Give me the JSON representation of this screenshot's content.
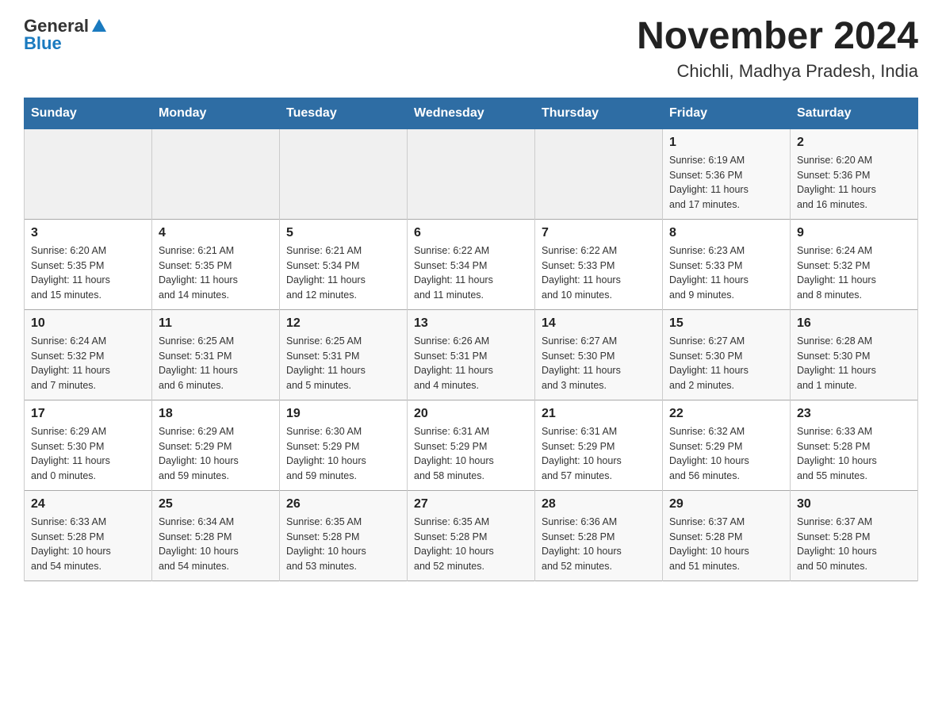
{
  "header": {
    "logo_general": "General",
    "logo_blue": "Blue",
    "month_title": "November 2024",
    "location": "Chichli, Madhya Pradesh, India"
  },
  "days_of_week": [
    "Sunday",
    "Monday",
    "Tuesday",
    "Wednesday",
    "Thursday",
    "Friday",
    "Saturday"
  ],
  "weeks": [
    [
      {
        "day": "",
        "info": ""
      },
      {
        "day": "",
        "info": ""
      },
      {
        "day": "",
        "info": ""
      },
      {
        "day": "",
        "info": ""
      },
      {
        "day": "",
        "info": ""
      },
      {
        "day": "1",
        "info": "Sunrise: 6:19 AM\nSunset: 5:36 PM\nDaylight: 11 hours\nand 17 minutes."
      },
      {
        "day": "2",
        "info": "Sunrise: 6:20 AM\nSunset: 5:36 PM\nDaylight: 11 hours\nand 16 minutes."
      }
    ],
    [
      {
        "day": "3",
        "info": "Sunrise: 6:20 AM\nSunset: 5:35 PM\nDaylight: 11 hours\nand 15 minutes."
      },
      {
        "day": "4",
        "info": "Sunrise: 6:21 AM\nSunset: 5:35 PM\nDaylight: 11 hours\nand 14 minutes."
      },
      {
        "day": "5",
        "info": "Sunrise: 6:21 AM\nSunset: 5:34 PM\nDaylight: 11 hours\nand 12 minutes."
      },
      {
        "day": "6",
        "info": "Sunrise: 6:22 AM\nSunset: 5:34 PM\nDaylight: 11 hours\nand 11 minutes."
      },
      {
        "day": "7",
        "info": "Sunrise: 6:22 AM\nSunset: 5:33 PM\nDaylight: 11 hours\nand 10 minutes."
      },
      {
        "day": "8",
        "info": "Sunrise: 6:23 AM\nSunset: 5:33 PM\nDaylight: 11 hours\nand 9 minutes."
      },
      {
        "day": "9",
        "info": "Sunrise: 6:24 AM\nSunset: 5:32 PM\nDaylight: 11 hours\nand 8 minutes."
      }
    ],
    [
      {
        "day": "10",
        "info": "Sunrise: 6:24 AM\nSunset: 5:32 PM\nDaylight: 11 hours\nand 7 minutes."
      },
      {
        "day": "11",
        "info": "Sunrise: 6:25 AM\nSunset: 5:31 PM\nDaylight: 11 hours\nand 6 minutes."
      },
      {
        "day": "12",
        "info": "Sunrise: 6:25 AM\nSunset: 5:31 PM\nDaylight: 11 hours\nand 5 minutes."
      },
      {
        "day": "13",
        "info": "Sunrise: 6:26 AM\nSunset: 5:31 PM\nDaylight: 11 hours\nand 4 minutes."
      },
      {
        "day": "14",
        "info": "Sunrise: 6:27 AM\nSunset: 5:30 PM\nDaylight: 11 hours\nand 3 minutes."
      },
      {
        "day": "15",
        "info": "Sunrise: 6:27 AM\nSunset: 5:30 PM\nDaylight: 11 hours\nand 2 minutes."
      },
      {
        "day": "16",
        "info": "Sunrise: 6:28 AM\nSunset: 5:30 PM\nDaylight: 11 hours\nand 1 minute."
      }
    ],
    [
      {
        "day": "17",
        "info": "Sunrise: 6:29 AM\nSunset: 5:30 PM\nDaylight: 11 hours\nand 0 minutes."
      },
      {
        "day": "18",
        "info": "Sunrise: 6:29 AM\nSunset: 5:29 PM\nDaylight: 10 hours\nand 59 minutes."
      },
      {
        "day": "19",
        "info": "Sunrise: 6:30 AM\nSunset: 5:29 PM\nDaylight: 10 hours\nand 59 minutes."
      },
      {
        "day": "20",
        "info": "Sunrise: 6:31 AM\nSunset: 5:29 PM\nDaylight: 10 hours\nand 58 minutes."
      },
      {
        "day": "21",
        "info": "Sunrise: 6:31 AM\nSunset: 5:29 PM\nDaylight: 10 hours\nand 57 minutes."
      },
      {
        "day": "22",
        "info": "Sunrise: 6:32 AM\nSunset: 5:29 PM\nDaylight: 10 hours\nand 56 minutes."
      },
      {
        "day": "23",
        "info": "Sunrise: 6:33 AM\nSunset: 5:28 PM\nDaylight: 10 hours\nand 55 minutes."
      }
    ],
    [
      {
        "day": "24",
        "info": "Sunrise: 6:33 AM\nSunset: 5:28 PM\nDaylight: 10 hours\nand 54 minutes."
      },
      {
        "day": "25",
        "info": "Sunrise: 6:34 AM\nSunset: 5:28 PM\nDaylight: 10 hours\nand 54 minutes."
      },
      {
        "day": "26",
        "info": "Sunrise: 6:35 AM\nSunset: 5:28 PM\nDaylight: 10 hours\nand 53 minutes."
      },
      {
        "day": "27",
        "info": "Sunrise: 6:35 AM\nSunset: 5:28 PM\nDaylight: 10 hours\nand 52 minutes."
      },
      {
        "day": "28",
        "info": "Sunrise: 6:36 AM\nSunset: 5:28 PM\nDaylight: 10 hours\nand 52 minutes."
      },
      {
        "day": "29",
        "info": "Sunrise: 6:37 AM\nSunset: 5:28 PM\nDaylight: 10 hours\nand 51 minutes."
      },
      {
        "day": "30",
        "info": "Sunrise: 6:37 AM\nSunset: 5:28 PM\nDaylight: 10 hours\nand 50 minutes."
      }
    ]
  ]
}
